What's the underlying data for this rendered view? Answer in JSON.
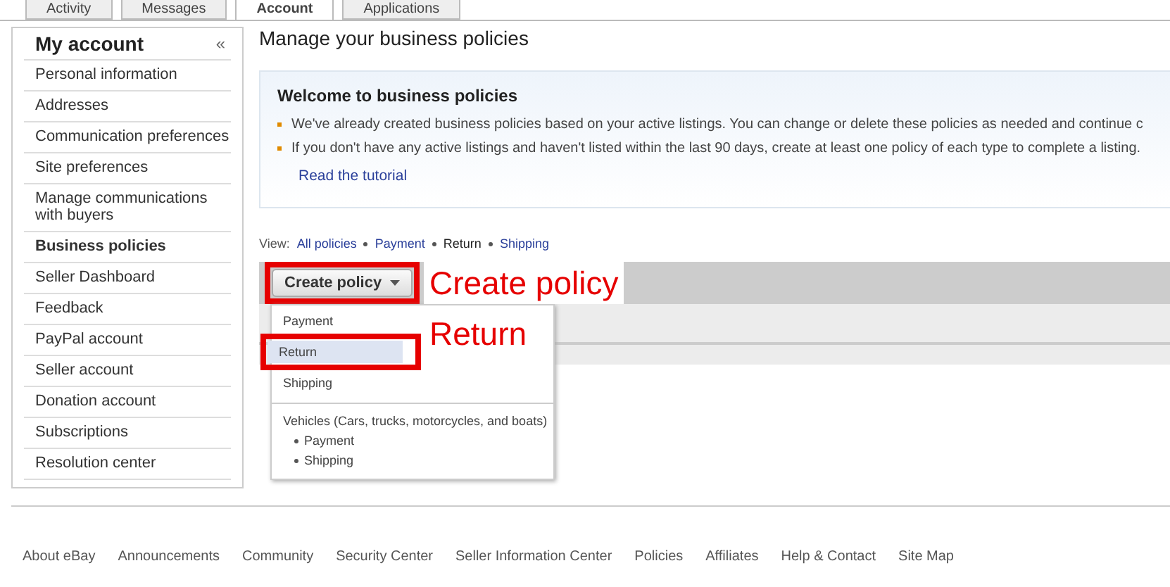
{
  "tabs": [
    {
      "label": "Activity",
      "selected": false
    },
    {
      "label": "Messages",
      "selected": false
    },
    {
      "label": "Account",
      "selected": true
    },
    {
      "label": "Applications",
      "selected": false
    }
  ],
  "sidebar": {
    "title": "My account",
    "collapse": "«",
    "items": [
      {
        "label": "Personal information",
        "selected": false
      },
      {
        "label": "Addresses",
        "selected": false
      },
      {
        "label": "Communication preferences",
        "selected": false
      },
      {
        "label": "Site preferences",
        "selected": false
      },
      {
        "label": "Manage communications with buyers",
        "selected": false
      },
      {
        "label": "Business policies",
        "selected": true
      },
      {
        "label": "Seller Dashboard",
        "selected": false
      },
      {
        "label": "Feedback",
        "selected": false
      },
      {
        "label": "PayPal account",
        "selected": false
      },
      {
        "label": "Seller account",
        "selected": false
      },
      {
        "label": "Donation account",
        "selected": false
      },
      {
        "label": "Subscriptions",
        "selected": false
      },
      {
        "label": "Resolution center",
        "selected": false
      }
    ]
  },
  "page_title": "Manage your business policies",
  "welcome": {
    "title": "Welcome to business policies",
    "bullets": [
      "We've already created business policies based on your active listings. You can change or delete these policies as needed and continue c",
      "If you don't have any active listings and haven't listed within the last 90 days, create at least one policy of each type to complete a listing."
    ],
    "link": "Read the tutorial"
  },
  "view": {
    "label": "View:",
    "options": [
      {
        "label": "All policies",
        "selected": false
      },
      {
        "label": "Payment",
        "selected": false
      },
      {
        "label": "Return",
        "selected": true
      },
      {
        "label": "Shipping",
        "selected": false
      }
    ]
  },
  "create_button": "Create policy",
  "menu": {
    "items": [
      {
        "label": "Payment",
        "selected": false
      },
      {
        "label": "Return",
        "selected": true
      },
      {
        "label": "Shipping",
        "selected": false
      }
    ],
    "group_label": "Vehicles (Cars, trucks, motorcycles, and boats)",
    "group_items": [
      "Payment",
      "Shipping"
    ]
  },
  "annotations": [
    "Create policy",
    "Return"
  ],
  "footer": [
    "About eBay",
    "Announcements",
    "Community",
    "Security Center",
    "Seller Information Center",
    "Policies",
    "Affiliates",
    "Help & Contact",
    "Site Map"
  ]
}
